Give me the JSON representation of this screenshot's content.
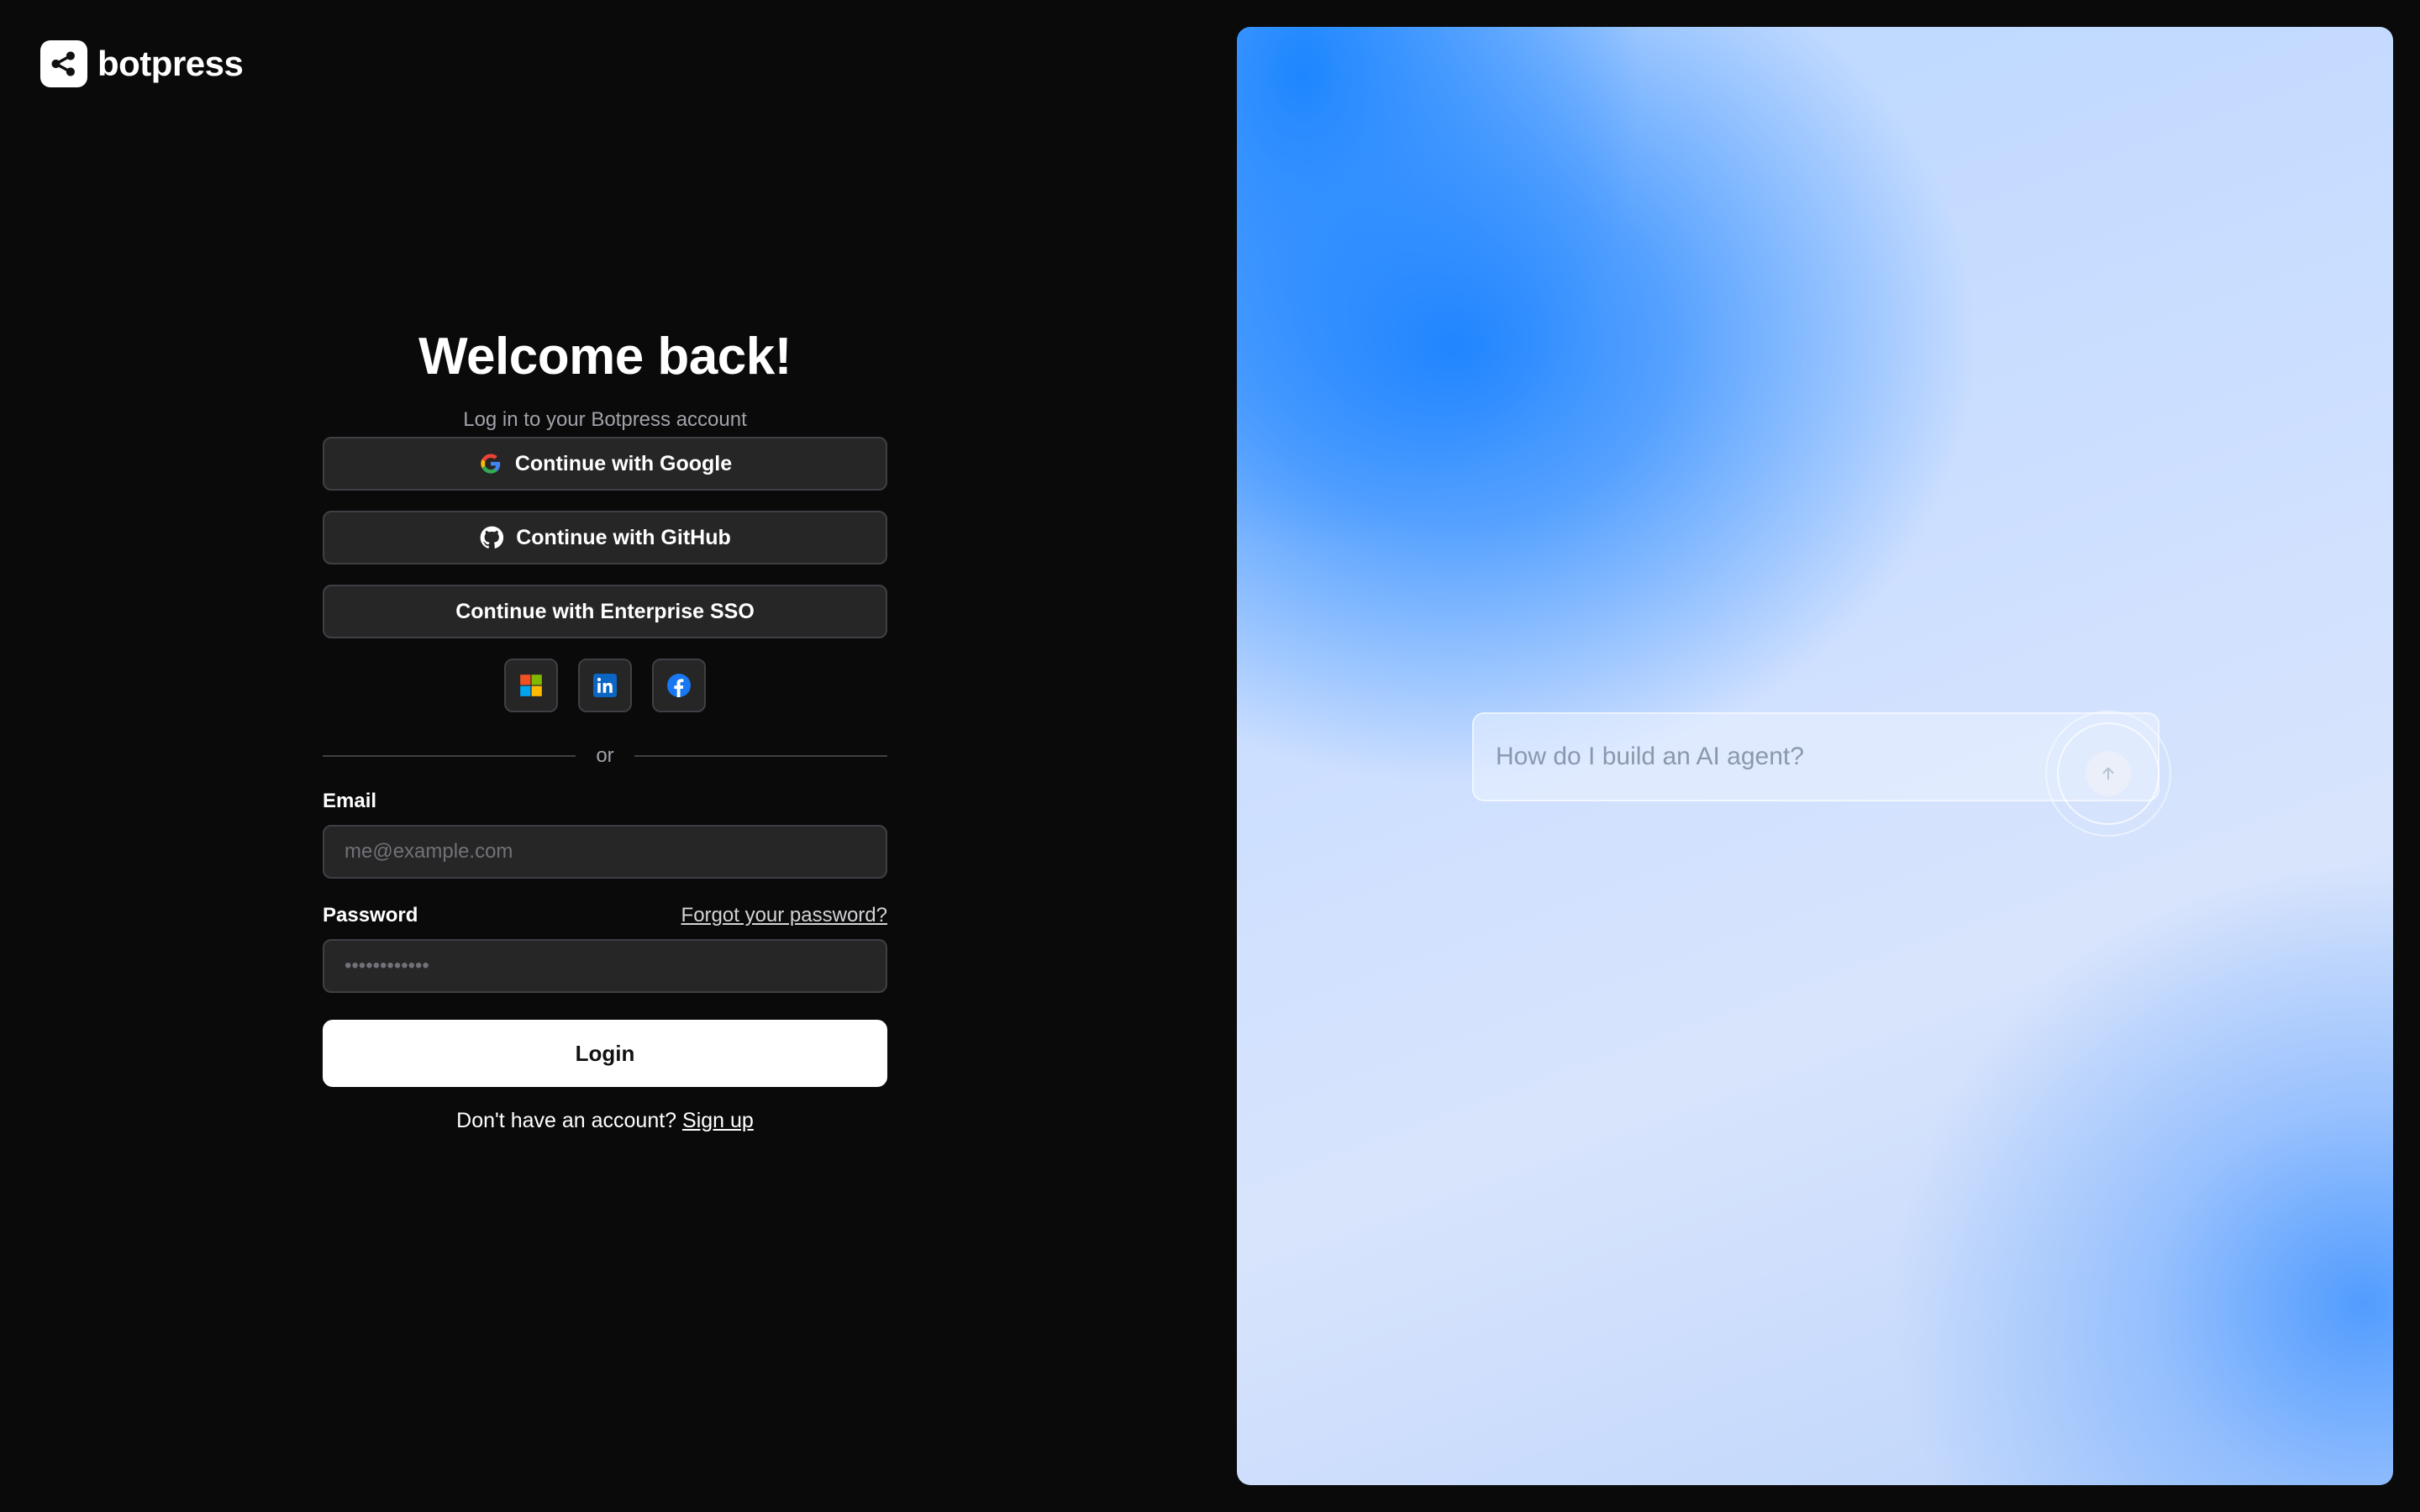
{
  "brand": {
    "name": "botpress"
  },
  "header": {
    "title": "Welcome back!",
    "subtitle": "Log in to your Botpress account"
  },
  "auth": {
    "google_label": "Continue with Google",
    "github_label": "Continue with GitHub",
    "sso_label": "Continue with Enterprise SSO",
    "social_icons": [
      "microsoft-icon",
      "linkedin-icon",
      "facebook-icon"
    ],
    "divider": "or"
  },
  "form": {
    "email_label": "Email",
    "email_placeholder": "me@example.com",
    "password_label": "Password",
    "password_placeholder": "••••••••••••",
    "forgot_label": "Forgot your password?",
    "login_label": "Login",
    "signup_prompt": "Don't have an account?",
    "signup_link": "Sign up"
  },
  "hero": {
    "prompt_text": "How do I build an AI agent?"
  },
  "colors": {
    "background": "#0a0a0a",
    "button_bg": "#262626",
    "hero_accent": "#1a82ff"
  }
}
